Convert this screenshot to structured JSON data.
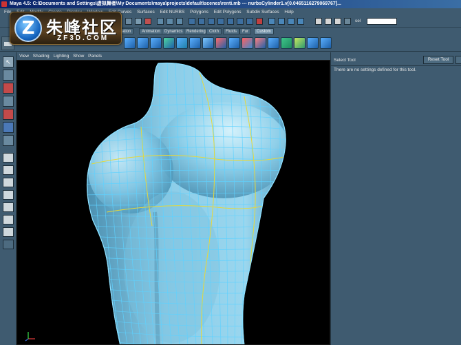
{
  "window": {
    "title": "Maya 4.5: C:\\Documents and Settings\\虚拟舞者\\My Documents\\maya\\projects\\default\\scenes\\renti.mb  ---  nurbsCylinder1.v[0.0465116279069767]..."
  },
  "menu": {
    "items": [
      "File",
      "Edit",
      "Modify",
      "Create",
      "Display",
      "Window",
      "Edit Curves",
      "Surfaces",
      "Edit NURBS",
      "Polygons",
      "Edit Polygons",
      "Subdiv Surfaces",
      "Help"
    ]
  },
  "statusline": {
    "sel_label": "sel",
    "sel_value": ""
  },
  "shelf_tabs": {
    "items": [
      "Animation",
      "Dynamics",
      "Rendering",
      "Cloth",
      "Fluids",
      "Fur",
      "Custom"
    ],
    "active": "Custom",
    "partial": "ization"
  },
  "panel_menu": {
    "items": [
      "View",
      "Shading",
      "Lighting",
      "Show",
      "Panels"
    ]
  },
  "tool_settings": {
    "title": "Select Tool",
    "reset_label": "Reset Tool",
    "message": "There are no settings defined for this tool."
  },
  "watermark": {
    "badge_letter": "Z",
    "name_cn": "朱峰社区",
    "name_en": "ZF3D.COM"
  },
  "colors": {
    "ui_bg": "#3f5b70",
    "surface": "#8fd0ea",
    "wire": "#5fd2ff",
    "isoparm_highlight": "#e6d83a"
  }
}
